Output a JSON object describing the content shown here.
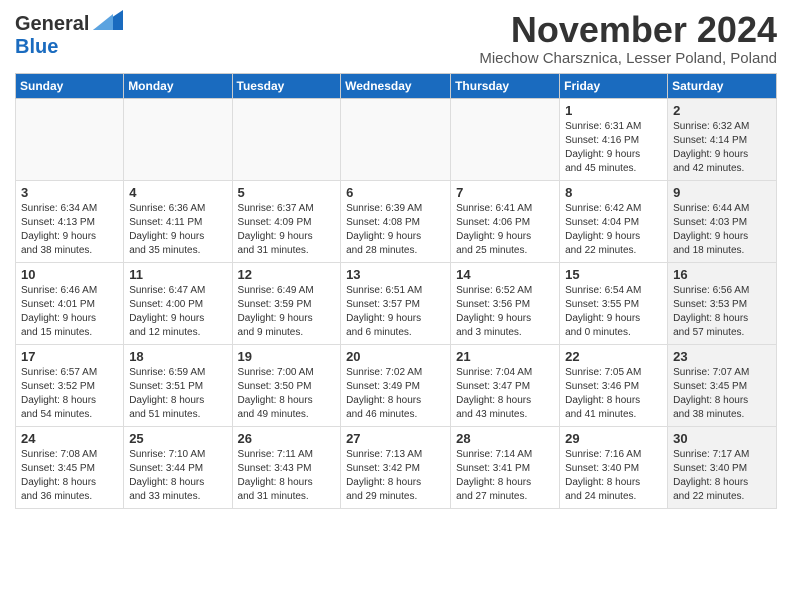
{
  "logo": {
    "general": "General",
    "blue": "Blue"
  },
  "header": {
    "month": "November 2024",
    "location": "Miechow Charsznica, Lesser Poland, Poland"
  },
  "weekdays": [
    "Sunday",
    "Monday",
    "Tuesday",
    "Wednesday",
    "Thursday",
    "Friday",
    "Saturday"
  ],
  "weeks": [
    [
      {
        "day": "",
        "info": "",
        "shaded": true
      },
      {
        "day": "",
        "info": "",
        "shaded": true
      },
      {
        "day": "",
        "info": "",
        "shaded": true
      },
      {
        "day": "",
        "info": "",
        "shaded": true
      },
      {
        "day": "",
        "info": "",
        "shaded": true
      },
      {
        "day": "1",
        "info": "Sunrise: 6:31 AM\nSunset: 4:16 PM\nDaylight: 9 hours\nand 45 minutes.",
        "shaded": false
      },
      {
        "day": "2",
        "info": "Sunrise: 6:32 AM\nSunset: 4:14 PM\nDaylight: 9 hours\nand 42 minutes.",
        "shaded": true
      }
    ],
    [
      {
        "day": "3",
        "info": "Sunrise: 6:34 AM\nSunset: 4:13 PM\nDaylight: 9 hours\nand 38 minutes.",
        "shaded": false
      },
      {
        "day": "4",
        "info": "Sunrise: 6:36 AM\nSunset: 4:11 PM\nDaylight: 9 hours\nand 35 minutes.",
        "shaded": false
      },
      {
        "day": "5",
        "info": "Sunrise: 6:37 AM\nSunset: 4:09 PM\nDaylight: 9 hours\nand 31 minutes.",
        "shaded": false
      },
      {
        "day": "6",
        "info": "Sunrise: 6:39 AM\nSunset: 4:08 PM\nDaylight: 9 hours\nand 28 minutes.",
        "shaded": false
      },
      {
        "day": "7",
        "info": "Sunrise: 6:41 AM\nSunset: 4:06 PM\nDaylight: 9 hours\nand 25 minutes.",
        "shaded": false
      },
      {
        "day": "8",
        "info": "Sunrise: 6:42 AM\nSunset: 4:04 PM\nDaylight: 9 hours\nand 22 minutes.",
        "shaded": false
      },
      {
        "day": "9",
        "info": "Sunrise: 6:44 AM\nSunset: 4:03 PM\nDaylight: 9 hours\nand 18 minutes.",
        "shaded": true
      }
    ],
    [
      {
        "day": "10",
        "info": "Sunrise: 6:46 AM\nSunset: 4:01 PM\nDaylight: 9 hours\nand 15 minutes.",
        "shaded": false
      },
      {
        "day": "11",
        "info": "Sunrise: 6:47 AM\nSunset: 4:00 PM\nDaylight: 9 hours\nand 12 minutes.",
        "shaded": false
      },
      {
        "day": "12",
        "info": "Sunrise: 6:49 AM\nSunset: 3:59 PM\nDaylight: 9 hours\nand 9 minutes.",
        "shaded": false
      },
      {
        "day": "13",
        "info": "Sunrise: 6:51 AM\nSunset: 3:57 PM\nDaylight: 9 hours\nand 6 minutes.",
        "shaded": false
      },
      {
        "day": "14",
        "info": "Sunrise: 6:52 AM\nSunset: 3:56 PM\nDaylight: 9 hours\nand 3 minutes.",
        "shaded": false
      },
      {
        "day": "15",
        "info": "Sunrise: 6:54 AM\nSunset: 3:55 PM\nDaylight: 9 hours\nand 0 minutes.",
        "shaded": false
      },
      {
        "day": "16",
        "info": "Sunrise: 6:56 AM\nSunset: 3:53 PM\nDaylight: 8 hours\nand 57 minutes.",
        "shaded": true
      }
    ],
    [
      {
        "day": "17",
        "info": "Sunrise: 6:57 AM\nSunset: 3:52 PM\nDaylight: 8 hours\nand 54 minutes.",
        "shaded": false
      },
      {
        "day": "18",
        "info": "Sunrise: 6:59 AM\nSunset: 3:51 PM\nDaylight: 8 hours\nand 51 minutes.",
        "shaded": false
      },
      {
        "day": "19",
        "info": "Sunrise: 7:00 AM\nSunset: 3:50 PM\nDaylight: 8 hours\nand 49 minutes.",
        "shaded": false
      },
      {
        "day": "20",
        "info": "Sunrise: 7:02 AM\nSunset: 3:49 PM\nDaylight: 8 hours\nand 46 minutes.",
        "shaded": false
      },
      {
        "day": "21",
        "info": "Sunrise: 7:04 AM\nSunset: 3:47 PM\nDaylight: 8 hours\nand 43 minutes.",
        "shaded": false
      },
      {
        "day": "22",
        "info": "Sunrise: 7:05 AM\nSunset: 3:46 PM\nDaylight: 8 hours\nand 41 minutes.",
        "shaded": false
      },
      {
        "day": "23",
        "info": "Sunrise: 7:07 AM\nSunset: 3:45 PM\nDaylight: 8 hours\nand 38 minutes.",
        "shaded": true
      }
    ],
    [
      {
        "day": "24",
        "info": "Sunrise: 7:08 AM\nSunset: 3:45 PM\nDaylight: 8 hours\nand 36 minutes.",
        "shaded": false
      },
      {
        "day": "25",
        "info": "Sunrise: 7:10 AM\nSunset: 3:44 PM\nDaylight: 8 hours\nand 33 minutes.",
        "shaded": false
      },
      {
        "day": "26",
        "info": "Sunrise: 7:11 AM\nSunset: 3:43 PM\nDaylight: 8 hours\nand 31 minutes.",
        "shaded": false
      },
      {
        "day": "27",
        "info": "Sunrise: 7:13 AM\nSunset: 3:42 PM\nDaylight: 8 hours\nand 29 minutes.",
        "shaded": false
      },
      {
        "day": "28",
        "info": "Sunrise: 7:14 AM\nSunset: 3:41 PM\nDaylight: 8 hours\nand 27 minutes.",
        "shaded": false
      },
      {
        "day": "29",
        "info": "Sunrise: 7:16 AM\nSunset: 3:40 PM\nDaylight: 8 hours\nand 24 minutes.",
        "shaded": false
      },
      {
        "day": "30",
        "info": "Sunrise: 7:17 AM\nSunset: 3:40 PM\nDaylight: 8 hours\nand 22 minutes.",
        "shaded": true
      }
    ]
  ]
}
